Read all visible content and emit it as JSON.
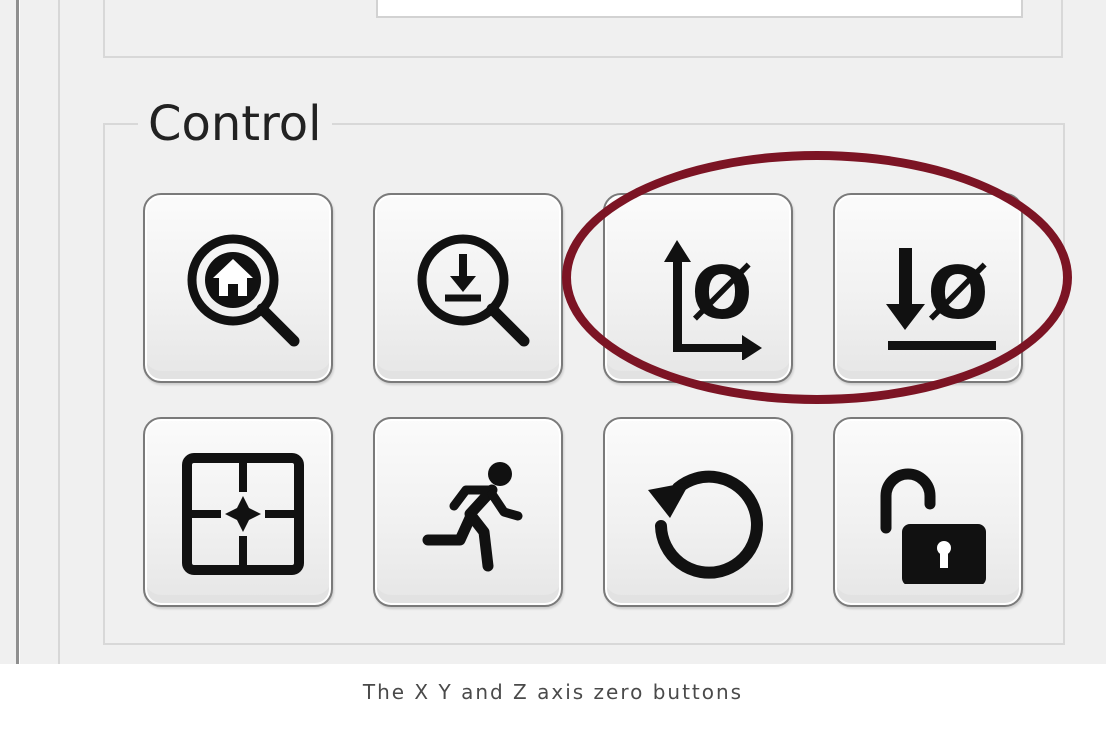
{
  "control_group": {
    "title": "Control",
    "buttons": [
      {
        "icon": "home-search-icon"
      },
      {
        "icon": "probe-search-icon"
      },
      {
        "icon": "xy-zero-icon",
        "glyph": "Ø"
      },
      {
        "icon": "z-zero-icon",
        "glyph": "Ø"
      },
      {
        "icon": "crosshair-target-icon"
      },
      {
        "icon": "running-man-icon"
      },
      {
        "icon": "reset-icon"
      },
      {
        "icon": "unlock-icon"
      }
    ]
  },
  "annotation": {
    "color": "#7c1424",
    "target": "xy-zero-button, z-zero-button"
  },
  "caption": "The X Y and Z axis zero buttons"
}
